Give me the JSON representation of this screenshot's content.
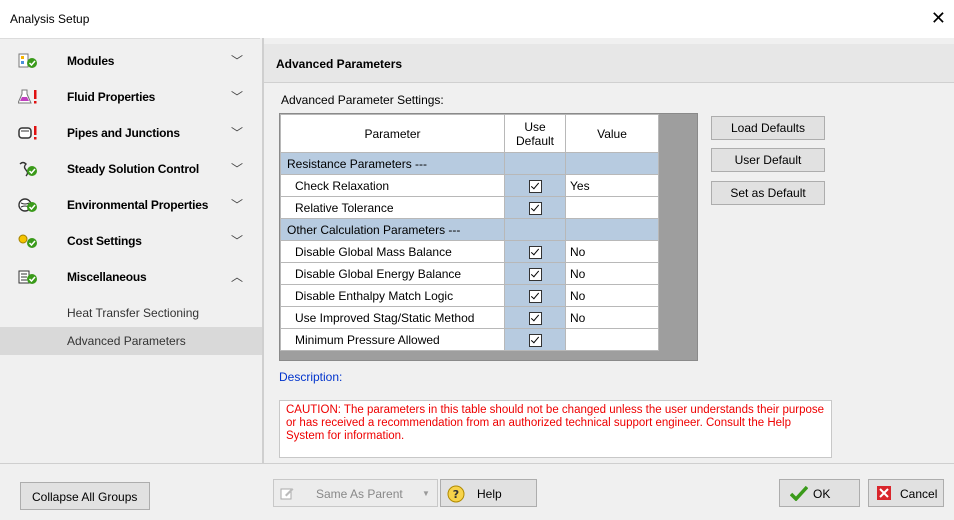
{
  "window": {
    "title": "Analysis Setup",
    "close_glyph": "✕"
  },
  "sidebar": {
    "groups": [
      {
        "label": "Modules",
        "icon": "modules-icon",
        "chevron": "﹀"
      },
      {
        "label": "Fluid Properties",
        "icon": "fluid-flask-icon",
        "chevron": "﹀"
      },
      {
        "label": "Pipes and Junctions",
        "icon": "pipe-icon",
        "chevron": "﹀"
      },
      {
        "label": "Steady Solution Control",
        "icon": "solution-control-icon",
        "chevron": "﹀"
      },
      {
        "label": "Environmental Properties",
        "icon": "environment-icon",
        "chevron": "﹀"
      },
      {
        "label": "Cost Settings",
        "icon": "cost-icon",
        "chevron": "﹀"
      },
      {
        "label": "Miscellaneous",
        "icon": "miscellaneous-icon",
        "chevron": "︿"
      }
    ],
    "sub_items": [
      {
        "label": "Heat Transfer Sectioning",
        "selected": false
      },
      {
        "label": "Advanced Parameters",
        "selected": true
      }
    ]
  },
  "panel": {
    "header": "Advanced Parameters",
    "settings_label": "Advanced Parameter Settings:",
    "table": {
      "headers": {
        "parameter": "Parameter",
        "use_default_1": "Use",
        "use_default_2": "Default",
        "value": "Value"
      },
      "sections": [
        {
          "title": "Resistance Parameters ---"
        },
        {
          "title": "Other Calculation Parameters ---"
        }
      ],
      "rows": [
        {
          "name": "Check Relaxation",
          "use_default": true,
          "value": "Yes"
        },
        {
          "name": "Relative Tolerance",
          "use_default": true,
          "value": ""
        },
        {
          "name": "Disable Global Mass Balance",
          "use_default": true,
          "value": "No"
        },
        {
          "name": "Disable Global Energy Balance",
          "use_default": true,
          "value": "No"
        },
        {
          "name": "Disable Enthalpy Match Logic",
          "use_default": true,
          "value": "No"
        },
        {
          "name": "Use Improved Stag/Static Method",
          "use_default": true,
          "value": "No"
        },
        {
          "name": "Minimum Pressure Allowed",
          "use_default": true,
          "value": ""
        }
      ]
    },
    "buttons": {
      "load_defaults": "Load Defaults",
      "user_default": "User Default",
      "set_as_default": "Set as Default"
    },
    "description_label": "Description:",
    "caution": "CAUTION: The parameters in this table should not be changed unless the user understands their purpose or has received a recommendation from an authorized technical support engineer. Consult the Help System for information."
  },
  "footer": {
    "collapse_all": "Collapse All Groups",
    "same_as_parent": "Same As Parent",
    "help": "Help",
    "ok": "OK",
    "cancel": "Cancel"
  },
  "colors": {
    "section_row": "#b7cbe0",
    "description_text": "#0033cc",
    "caution_text": "#ee0000",
    "ok_check": "#3a9a1a",
    "cancel_icon": "#d9262c"
  }
}
